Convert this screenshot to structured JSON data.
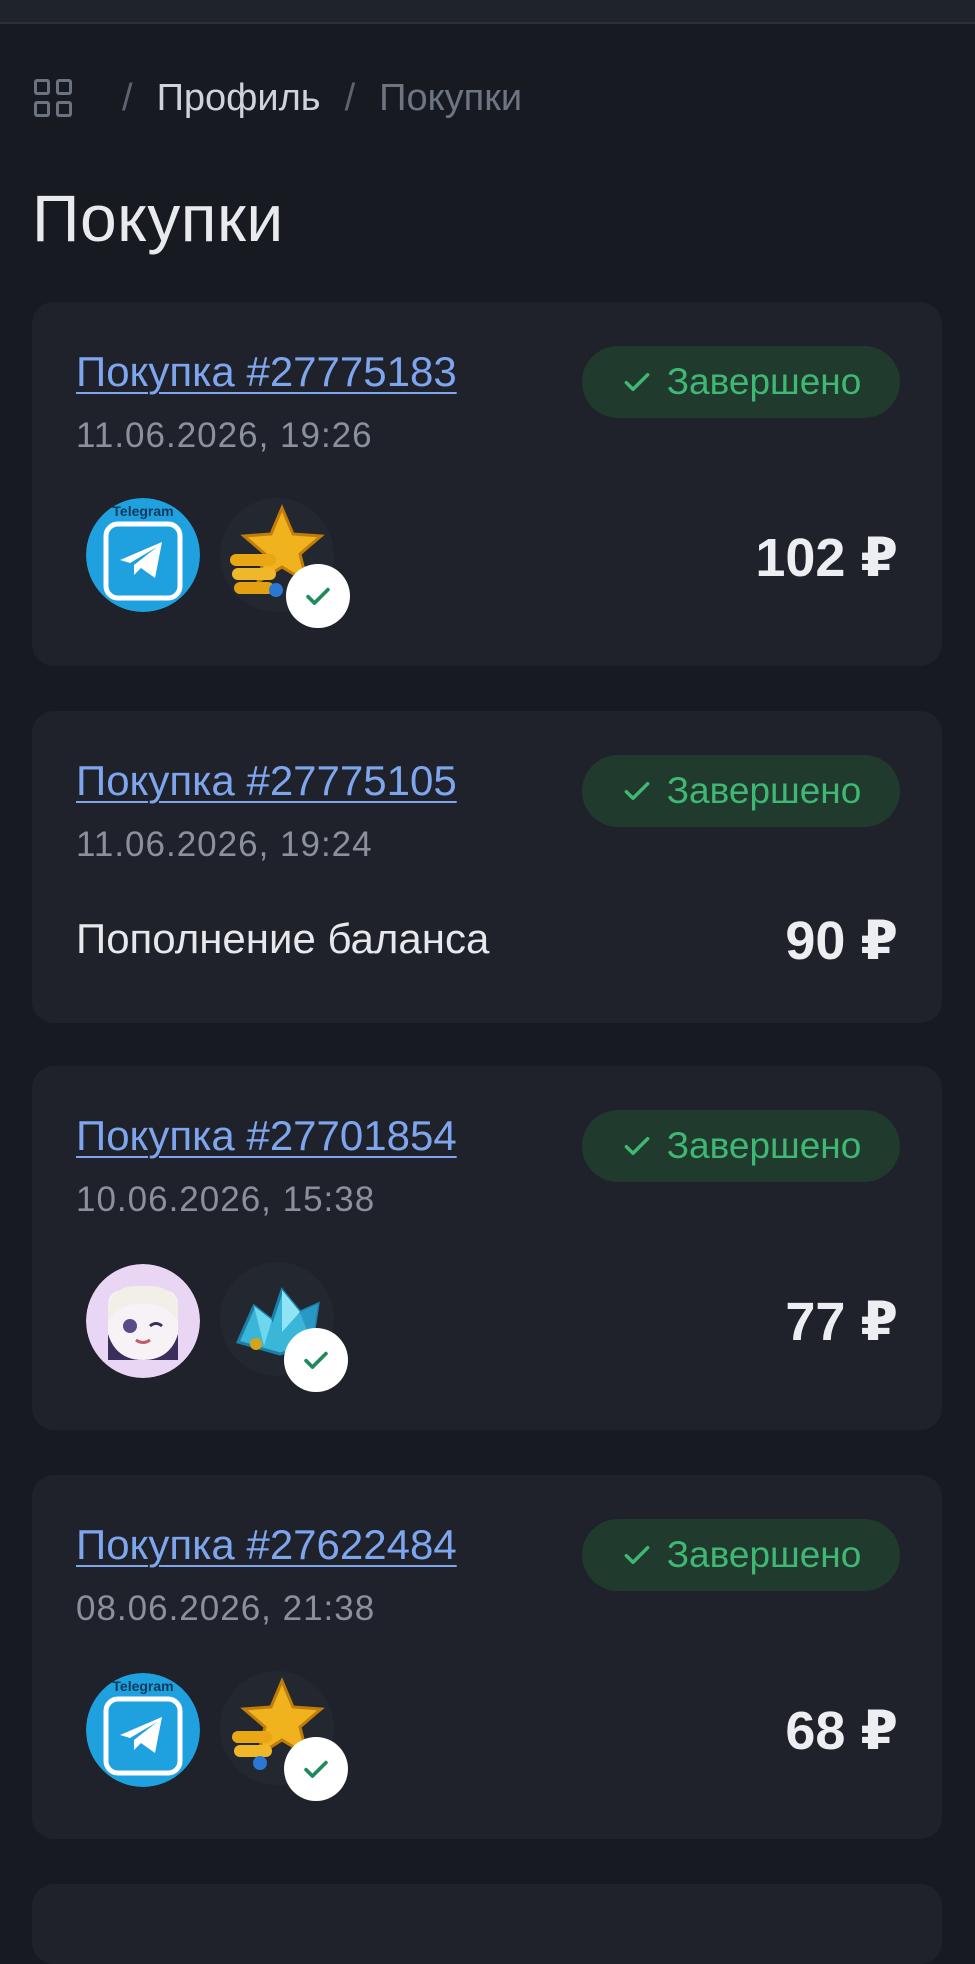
{
  "breadcrumb": {
    "home_icon": "grid-icon",
    "separator": "/",
    "profile": "Профиль",
    "current": "Покупки"
  },
  "page_title": "Покупки",
  "colors": {
    "background": "#171a21",
    "card": "#1f222a",
    "link": "#7ea6ef",
    "status_bg": "#203a2d",
    "status_text": "#3fb873"
  },
  "purchases": [
    {
      "title": "Покупка #27775183",
      "date": "11.06.2026, 19:26",
      "status": "Завершено",
      "price": "102 ₽",
      "game_icon": "telegram-icon",
      "product_icon": "telegram-stars-icon",
      "product_label": "Telegram"
    },
    {
      "title": "Покупка #27775105",
      "date": "11.06.2026, 19:24",
      "status": "Завершено",
      "price": "90 ₽",
      "description": "Пополнение баланса"
    },
    {
      "title": "Покупка #27701854",
      "date": "10.06.2026, 15:38",
      "status": "Завершено",
      "price": "77 ₽",
      "game_icon": "anime-character-icon",
      "product_icon": "crystal-icon"
    },
    {
      "title": "Покупка #27622484",
      "date": "08.06.2026, 21:38",
      "status": "Завершено",
      "price": "68 ₽",
      "game_icon": "telegram-icon",
      "product_icon": "telegram-stars-icon",
      "product_label": "Telegram"
    }
  ]
}
